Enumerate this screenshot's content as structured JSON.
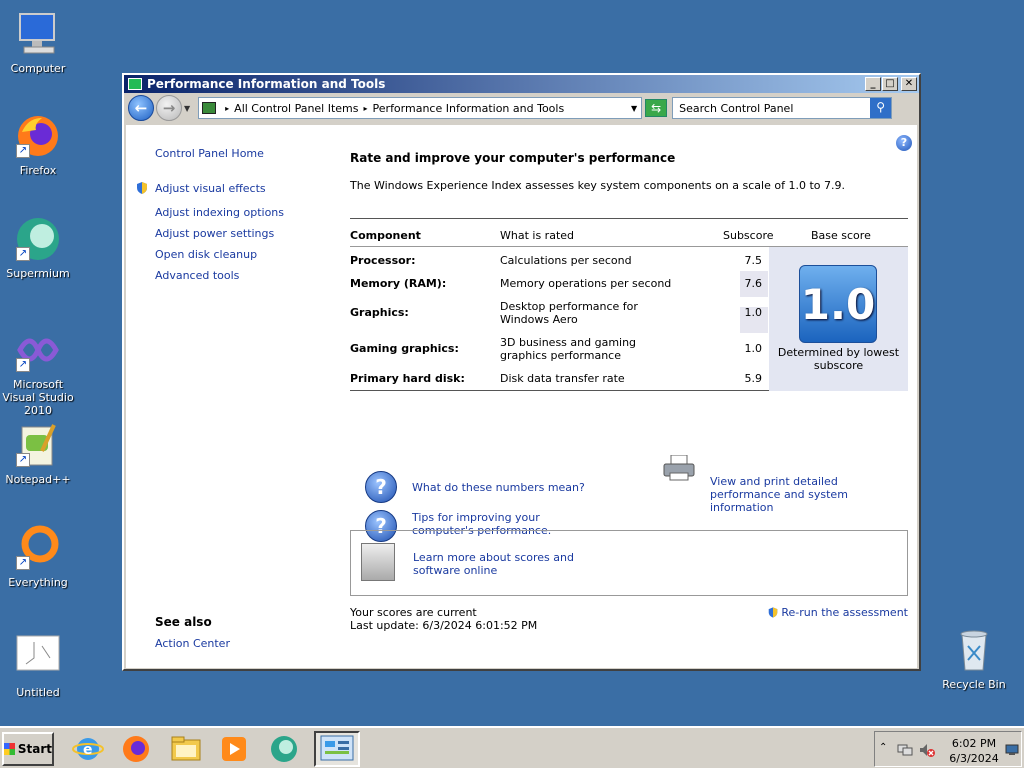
{
  "desktop": {
    "icons": [
      {
        "label": "Computer"
      },
      {
        "label": "Firefox"
      },
      {
        "label": "Supermium"
      },
      {
        "label": "Microsoft Visual Studio 2010"
      },
      {
        "label": "Notepad++"
      },
      {
        "label": "Everything"
      },
      {
        "label": "Untitled"
      },
      {
        "label": "Recycle Bin"
      }
    ]
  },
  "window": {
    "title": "Performance Information and Tools",
    "controls": {
      "minimize": "_",
      "maximize": "□",
      "close": "✕"
    },
    "address": {
      "segments": [
        "All Control Panel Items",
        "Performance Information and Tools"
      ]
    },
    "search": {
      "placeholder": "Search Control Panel"
    }
  },
  "sidebar": {
    "home": "Control Panel Home",
    "links": [
      "Adjust visual effects",
      "Adjust indexing options",
      "Adjust power settings",
      "Open disk cleanup",
      "Advanced tools"
    ],
    "see_also_title": "See also",
    "see_also": [
      "Action Center"
    ]
  },
  "main": {
    "heading": "Rate and improve your computer's performance",
    "intro": "The Windows Experience Index assesses key system components on a scale of 1.0 to 7.9.",
    "table": {
      "headers": {
        "component": "Component",
        "rated": "What is rated",
        "subscore": "Subscore",
        "base": "Base score"
      },
      "rows": [
        {
          "component": "Processor:",
          "rated": "Calculations per second",
          "subscore": "7.5"
        },
        {
          "component": "Memory (RAM):",
          "rated": "Memory operations per second",
          "subscore": "7.6"
        },
        {
          "component": "Graphics:",
          "rated": "Desktop performance for Windows Aero",
          "subscore": "1.0"
        },
        {
          "component": "Gaming graphics:",
          "rated": "3D business and gaming graphics performance",
          "subscore": "1.0"
        },
        {
          "component": "Primary hard disk:",
          "rated": "Disk data transfer rate",
          "subscore": "5.9"
        }
      ],
      "base_score": "1.0",
      "base_caption": "Determined by lowest subscore"
    },
    "links": {
      "what_numbers": "What do these numbers mean?",
      "tips": "Tips for improving your computer's performance.",
      "view_print": "View and print detailed performance and system information",
      "learn_more": "Learn more about scores and software online"
    },
    "status": {
      "current": "Your scores are current",
      "last_update": "Last update: 6/3/2024 6:01:52 PM",
      "rerun": "Re-run the assessment"
    }
  },
  "taskbar": {
    "start": "Start",
    "clock": {
      "time": "6:02 PM",
      "date": "6/3/2024"
    }
  }
}
